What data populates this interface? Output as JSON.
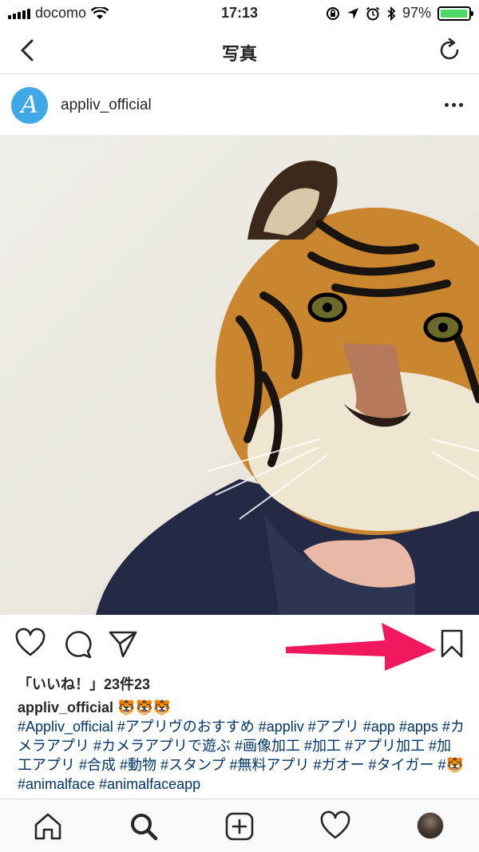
{
  "status_bar": {
    "carrier": "docomo",
    "time": "17:13",
    "battery_percent": "97%",
    "battery_level": 0.97,
    "accent_green": "#4cd964"
  },
  "navbar": {
    "title": "写真",
    "back_icon": "chevron-left-icon",
    "refresh_icon": "refresh-icon"
  },
  "post": {
    "avatar_letter": "A",
    "username": "appliv_official",
    "more_icon": "ellipsis-icon",
    "image_icon": "tiger-face-person-photo"
  },
  "actions": {
    "like_icon": "heart-icon",
    "comment_icon": "comment-icon",
    "share_icon": "send-icon",
    "save_icon": "bookmark-icon",
    "arrow_color": "#f0195e"
  },
  "likes_text": "「いいね！」23件23",
  "caption": {
    "user": "appliv_official",
    "emoji": "🐯🐯🐯",
    "text": "#Appliv_official #アプリヴのおすすめ #appliv #アプリ #app #apps #カメラアプリ #カメラアプリで遊ぶ #画像加工 #加工 #アプリ加工 #加工アプリ #合成 #動物 #スタンプ #無料アプリ #ガオー #タイガー #🐯 #animalface #animalfaceapp"
  },
  "tabbar": {
    "items": [
      "home-icon",
      "search-icon",
      "add-post-icon",
      "activity-heart-icon",
      "profile-avatar"
    ]
  }
}
